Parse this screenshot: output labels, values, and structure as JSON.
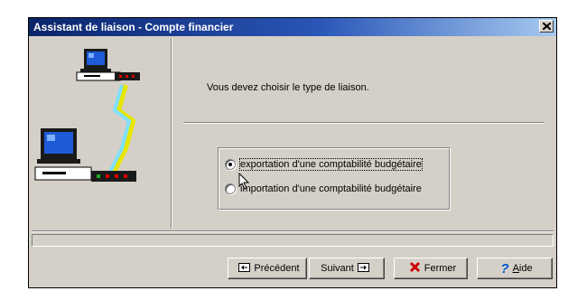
{
  "window": {
    "title": "Assistant de liaison - Compte financier",
    "close_label": "×"
  },
  "main": {
    "prompt": "Vous devez choisir le type de liaison.",
    "options": [
      {
        "label": "exportation d'une comptabilité budgétaire",
        "checked": true
      },
      {
        "label": "importation d'une comptabilité budgétaire",
        "checked": false
      }
    ]
  },
  "buttons": {
    "previous": "Précédent",
    "next": "Suivant",
    "close": "Fermer",
    "help_prefix": "",
    "help_underlined": "A",
    "help_rest": "ide"
  },
  "icons": {
    "computer": "computer-icon",
    "link": "lightning-link-icon",
    "previous": "previous-icon",
    "next": "next-icon",
    "close": "red-x-icon",
    "help": "question-mark-icon"
  },
  "colors": {
    "titlebar_start": "#0a246a",
    "titlebar_end": "#a6caf0",
    "face": "#d4d0c8",
    "close_x": "#cc0000",
    "help_q": "#0055cc"
  }
}
